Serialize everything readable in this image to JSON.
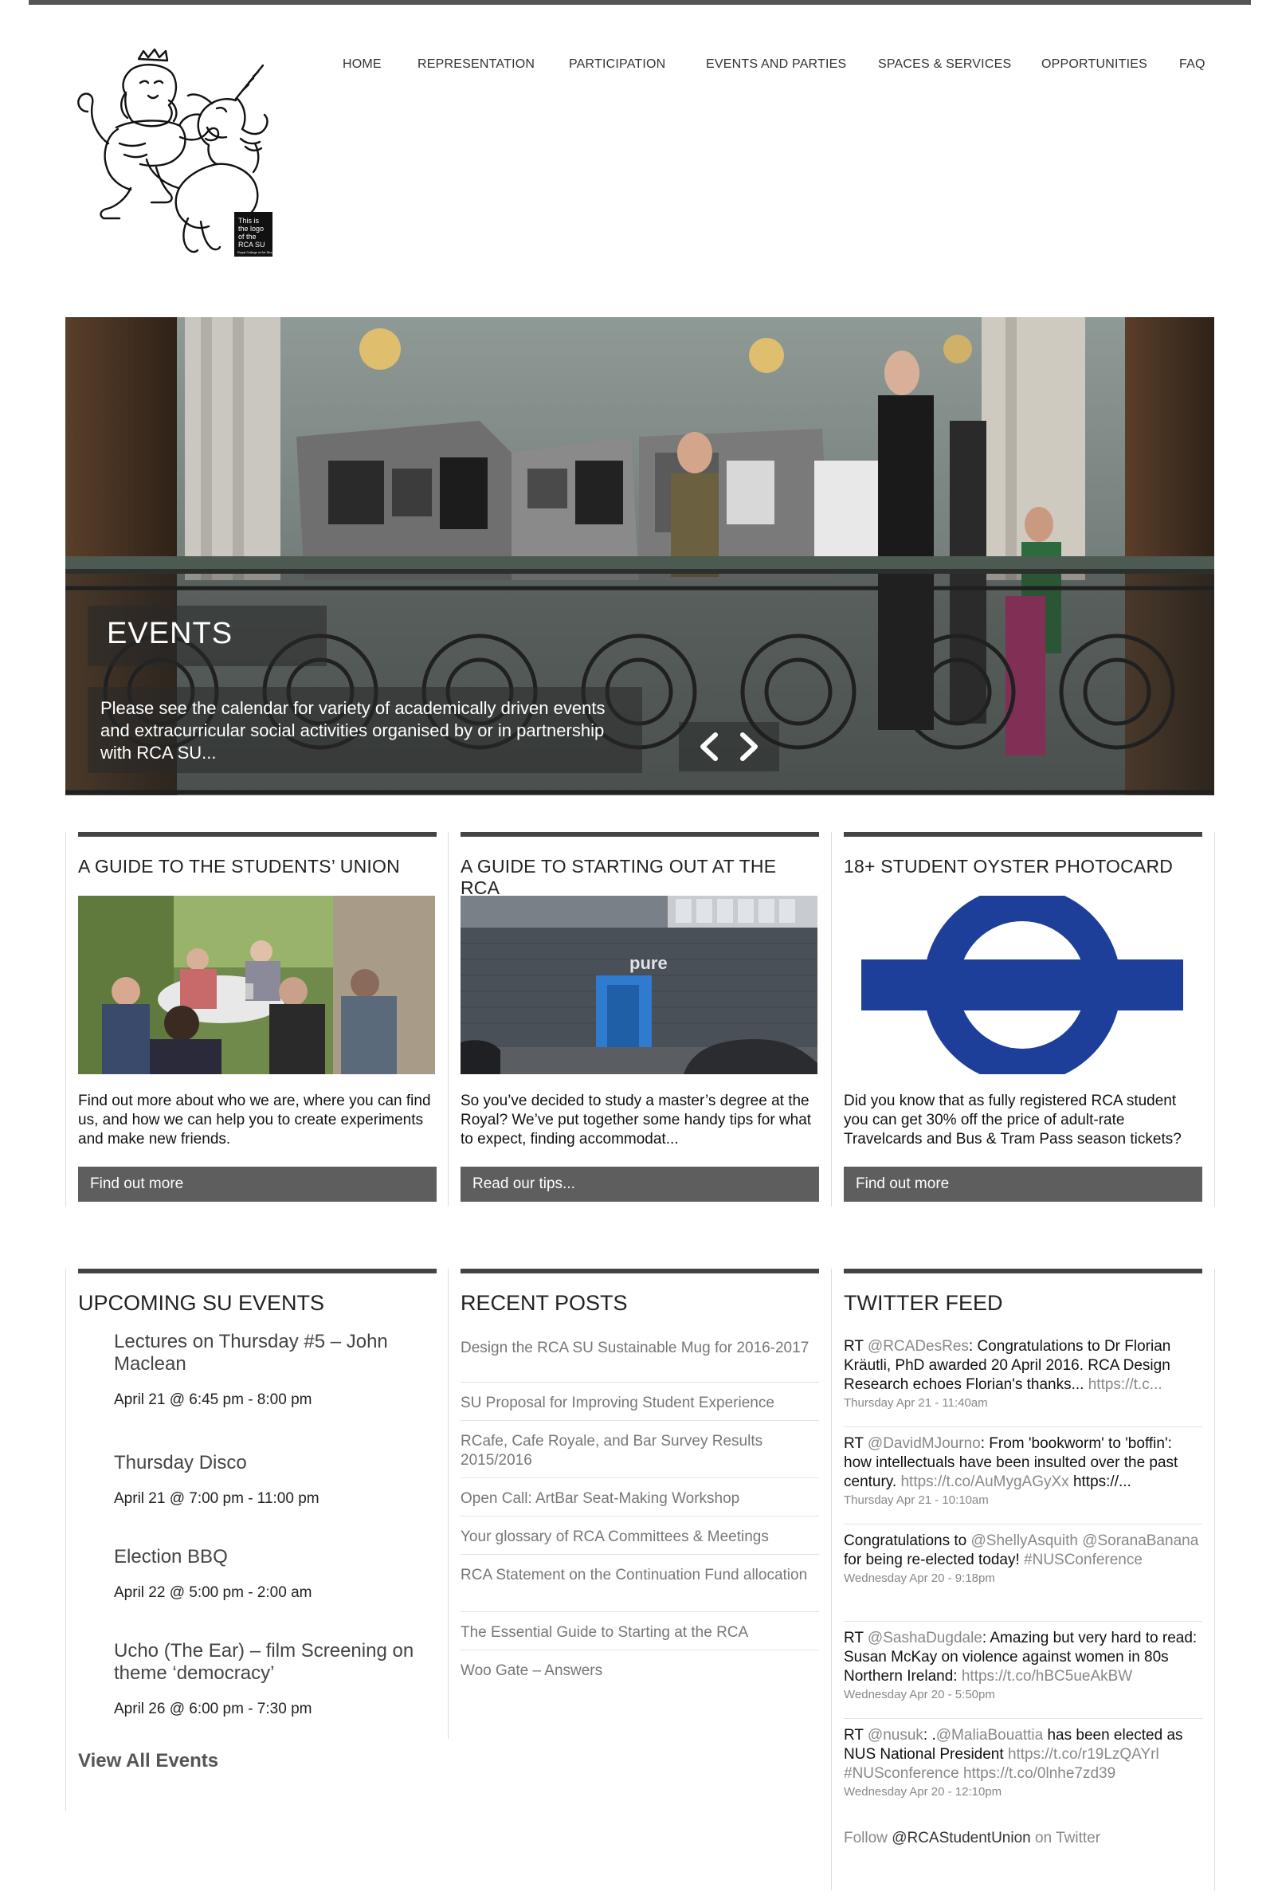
{
  "nav": {
    "items": [
      "HOME",
      "REPRESENTATION",
      "PARTICIPATION",
      "EVENTS AND PARTIES",
      "SPACES & SERVICES",
      "OPPORTUNITIES",
      "FAQ"
    ]
  },
  "logo": {
    "text": "This is the logo of the RCA SU",
    "small_text": "Royal College of Art Students' Union"
  },
  "hero": {
    "title": "EVENTS",
    "caption": "Please see the calendar for variety of academically driven events and extracurricular social activities organised by or in partnership with RCA SU..."
  },
  "cards": [
    {
      "heading": "A GUIDE TO THE STUDENTS’ UNION",
      "text": "Find out more about who we are, where you can find us, and how we can help you to create experiments and make new friends.",
      "button": "Find out more"
    },
    {
      "heading": "A GUIDE TO STARTING OUT AT THE RCA",
      "text": "So you’ve decided to study a master’s degree at the Royal? We’ve put together some handy tips for what to expect, finding accommodat...",
      "button": "Read our tips...",
      "sign": "pure"
    },
    {
      "heading": "18+ STUDENT OYSTER PHOTOCARD",
      "text": "Did you know that as fully registered RCA student you can get 30% off the price of adult-rate Travelcards and Bus & Tram Pass season tickets?",
      "button": "Find out more"
    }
  ],
  "events": {
    "heading": "UPCOMING SU EVENTS",
    "items": [
      {
        "title": "Lectures on Thursday #5 – John Maclean",
        "date": "April 21 @ 6:45 pm - 8:00 pm"
      },
      {
        "title": "Thursday Disco",
        "date": "April 21 @ 7:00 pm - 11:00 pm"
      },
      {
        "title": "Election BBQ",
        "date": "April 22 @ 5:00 pm - 2:00 am"
      },
      {
        "title": "Ucho (The Ear) – film Screening on theme ‘democracy’",
        "date": "April 26 @ 6:00 pm - 7:30 pm"
      }
    ],
    "view_all": "View All Events"
  },
  "posts": {
    "heading": "RECENT POSTS",
    "items": [
      "Design the RCA SU Sustainable Mug for 2016-2017",
      "SU Proposal for Improving Student Experience",
      "RCafe, Cafe Royale, and Bar Survey Results 2015/2016",
      "Open Call: ArtBar Seat-Making Workshop",
      "Your glossary of RCA Committees & Meetings",
      "RCA Statement on the Continuation Fund allocation",
      "The Essential Guide to Starting at the RCA",
      "Woo Gate – Answers"
    ]
  },
  "twitter": {
    "heading": "TWITTER FEED",
    "tweets": [
      {
        "parts": [
          "RT ",
          "@RCADesRes",
          ": Congratulations to Dr Florian Kräutli, PhD awarded 20 April 2016. RCA Design Research echoes Florian's thanks... ",
          "https://t.c..."
        ],
        "time": "Thursday Apr 21 - 11:40am"
      },
      {
        "parts": [
          "RT ",
          "@DavidMJourno",
          ": From 'bookworm' to 'boffin': how intellectuals have been insulted over the past century. ",
          "https://t.co/AuMygAGyXx",
          " https://..."
        ],
        "time": "Thursday Apr 21 - 10:10am"
      },
      {
        "parts": [
          "Congratulations to ",
          "@ShellyAsquith",
          " ",
          "@SoranaBanana",
          " for being re-elected today! ",
          "#NUSConference"
        ],
        "time": "Wednesday Apr 20 - 9:18pm"
      },
      {
        "parts": [
          "RT ",
          "@SashaDugdale",
          ": Amazing but very hard to read: Susan McKay on violence against women in 80s Northern Ireland: ",
          "https://t.co/hBC5ueAkBW"
        ],
        "time": "Wednesday Apr 20 - 5:50pm"
      },
      {
        "parts": [
          "RT ",
          "@nusuk",
          ": .",
          "@MaliaBouattia",
          " has been elected as NUS National President ",
          "https://t.co/r19LzQAYrl",
          " ",
          "#NUSconference",
          " ",
          "https://t.co/0lnhe7zd39"
        ],
        "time": "Wednesday Apr 20 - 12:10pm"
      }
    ],
    "follow_prefix": "Follow ",
    "follow_handle": "@RCAStudentUnion",
    "follow_suffix": " on Twitter"
  },
  "colors": {
    "roundel": "#1d3f99",
    "button": "#5e5e5e",
    "rule": "#444444"
  }
}
